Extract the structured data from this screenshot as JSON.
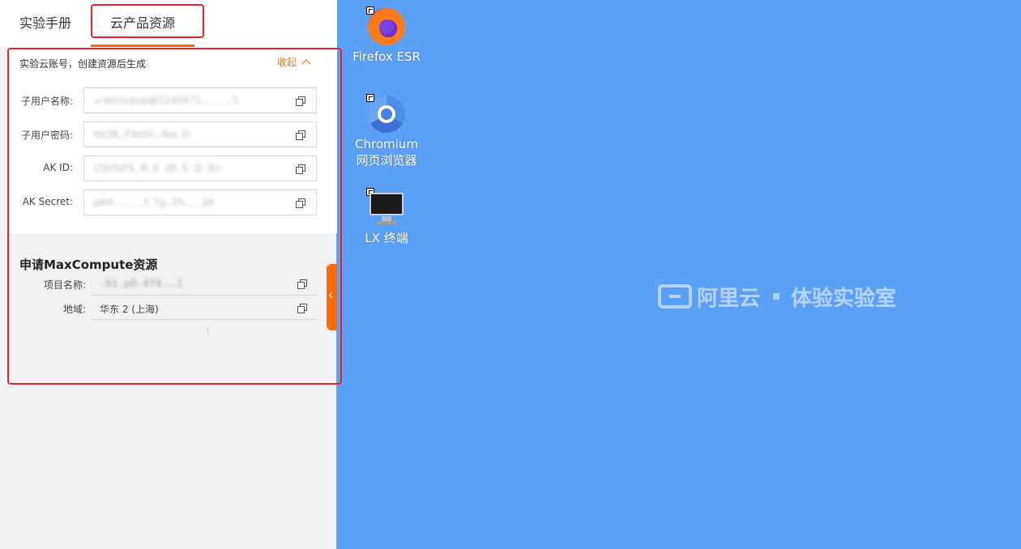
{
  "tabs": {
    "manual": "实验手册",
    "resources": "云产品资源"
  },
  "account": {
    "title": "实验云账号，创建资源后生成",
    "collapse_label": "收起",
    "fields": [
      {
        "label": "子用户名称:",
        "value": "u-leb1cpop@1240071..........5"
      },
      {
        "label": "子用户密码:",
        "value": "Ke3B..FXe5C..Nw..D"
      },
      {
        "label": "AK ID:",
        "value": "LTAI5tF5..R..E..8F..S..D..Bn"
      },
      {
        "label": "AK Secret:",
        "value": "p8d..........Y..Tg..2h......lj6"
      }
    ]
  },
  "maxcompute": {
    "title": "申请MaxCompute资源",
    "project_label": "项目名称:",
    "project_value": "..b1..p0..474.....1",
    "region_label": "地域:",
    "region_value": "华东 2 (上海)"
  },
  "desktop": {
    "icons": [
      {
        "name": "Firefox ESR",
        "icon": "firefox-icon"
      },
      {
        "name_line1": "Chromium",
        "name_line2": "网页浏览器",
        "icon": "chromium-icon"
      },
      {
        "name": "LX 终端",
        "icon": "terminal-icon"
      }
    ],
    "watermark_brand": "阿里云",
    "watermark_text": "体验实验室"
  },
  "colors": {
    "accent": "#ff6a00",
    "highlight": "#e5252a",
    "desktop_bg": "#5aa0f7"
  }
}
